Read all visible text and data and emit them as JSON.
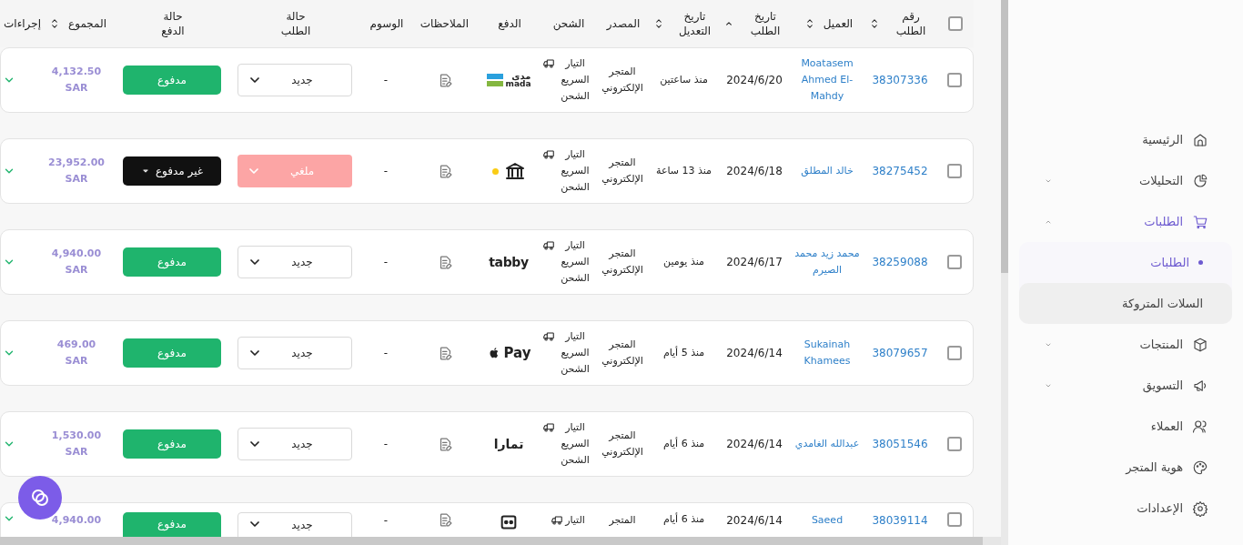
{
  "table": {
    "select_all": {
      "checked": false
    },
    "columns": [
      {
        "label": "رقم الطلب",
        "sortable": true,
        "sorted": false
      },
      {
        "label": "العميل",
        "sortable": true,
        "sorted": false
      },
      {
        "label": "تاريخ الطلب",
        "sortable": true,
        "sorted": true
      },
      {
        "label": "تاريخ التعديل",
        "sortable": true,
        "sorted": false
      },
      {
        "label": "المصدر"
      },
      {
        "label": "الشحن"
      },
      {
        "label": "الدفع"
      },
      {
        "label": "الملاحظات"
      },
      {
        "label": "الوسوم"
      },
      {
        "label": "حالة الطلب"
      },
      {
        "label": "حالة الدفع"
      },
      {
        "label": "المجموع",
        "sortable": true,
        "sorted": false
      },
      {
        "label": "إجراءات"
      }
    ],
    "rows": [
      {
        "checked": false,
        "order_number": "38307336",
        "customer": "Moatasem Ahmed El-Mahdy",
        "order_date": "2024/6/20",
        "modified": "منذ ساعتين",
        "source": "المتجر الإلكتروني",
        "shipping": "التيار السريع الشحن",
        "payment": {
          "kind": "mada",
          "logo_text": [
            "مدى",
            "mada"
          ]
        },
        "tags": "-",
        "order_status": {
          "kind": "new",
          "label": "جديد"
        },
        "payment_status": {
          "kind": "paid",
          "label": "مدفوع"
        },
        "total": "4,132.50",
        "currency": "SAR"
      },
      {
        "checked": false,
        "order_number": "38275452",
        "customer": "خالد المطلق",
        "order_date": "2024/6/18",
        "modified": "منذ 13 ساعة",
        "source": "المتجر الإلكتروني",
        "shipping": "التيار السريع الشحن",
        "payment": {
          "kind": "bank",
          "color": "#facc15"
        },
        "tags": "-",
        "order_status": {
          "kind": "cancelled",
          "label": "ملغي"
        },
        "payment_status": {
          "kind": "unpaid",
          "label": "غير مدفوع"
        },
        "total": "23,952.00",
        "currency": "SAR"
      },
      {
        "checked": false,
        "order_number": "38259088",
        "customer": "محمد زيد محمد الصيرم",
        "order_date": "2024/6/17",
        "modified": "منذ يومين",
        "source": "المتجر الإلكتروني",
        "shipping": "التيار السريع الشحن",
        "payment": {
          "kind": "tabby",
          "logo_text": [
            "tabby"
          ]
        },
        "tags": "-",
        "order_status": {
          "kind": "new",
          "label": "جديد"
        },
        "payment_status": {
          "kind": "paid",
          "label": "مدفوع"
        },
        "total": "4,940.00",
        "currency": "SAR"
      },
      {
        "checked": false,
        "order_number": "38079657",
        "customer": "Sukainah Khamees",
        "order_date": "2024/6/14",
        "modified": "منذ 5 أيام",
        "source": "المتجر الإلكتروني",
        "shipping": "التيار السريع الشحن",
        "payment": {
          "kind": "applepay",
          "logo_text": [
            "Pay"
          ]
        },
        "tags": "-",
        "order_status": {
          "kind": "new",
          "label": "جديد"
        },
        "payment_status": {
          "kind": "paid",
          "label": "مدفوع"
        },
        "total": "469.00",
        "currency": "SAR"
      },
      {
        "checked": false,
        "order_number": "38051546",
        "customer": "عبدالله الغامدي",
        "order_date": "2024/6/14",
        "modified": "منذ 6 أيام",
        "source": "المتجر الإلكتروني",
        "shipping": "التيار السريع الشحن",
        "payment": {
          "kind": "tamara",
          "logo_text": [
            "تمارا"
          ]
        },
        "tags": "-",
        "order_status": {
          "kind": "new",
          "label": "جديد"
        },
        "payment_status": {
          "kind": "paid",
          "label": "مدفوع"
        },
        "total": "1,530.00",
        "currency": "SAR"
      },
      {
        "checked": false,
        "order_number": "38039114",
        "customer": "Saeed",
        "order_date": "2024/6/14",
        "modified": "منذ 6 أيام",
        "source": "المتجر",
        "shipping": "التيار",
        "payment": {
          "kind": "other"
        },
        "tags": "-",
        "order_status": {
          "kind": "new",
          "label": "جديد"
        },
        "payment_status": {
          "kind": "paid",
          "label": "مدفوع"
        },
        "total": "4,940.00"
      }
    ]
  },
  "sidebar": {
    "items": [
      {
        "label": "الرئيسية",
        "selected": false
      },
      {
        "label": "التحليلات",
        "selected": false,
        "expanded": false
      },
      {
        "label": "الطلبات",
        "selected": true,
        "expanded": true,
        "children": [
          {
            "label": "الطلبات",
            "selected": true
          },
          {
            "label": "السلات المتروكة",
            "selected": false
          }
        ]
      },
      {
        "label": "المنتجات",
        "selected": false,
        "expanded": false
      },
      {
        "label": "التسويق",
        "selected": false,
        "expanded": false
      },
      {
        "label": "العملاء",
        "selected": false
      },
      {
        "label": "هوية المتجر",
        "selected": false
      },
      {
        "label": "الإعدادات",
        "selected": false
      }
    ]
  }
}
